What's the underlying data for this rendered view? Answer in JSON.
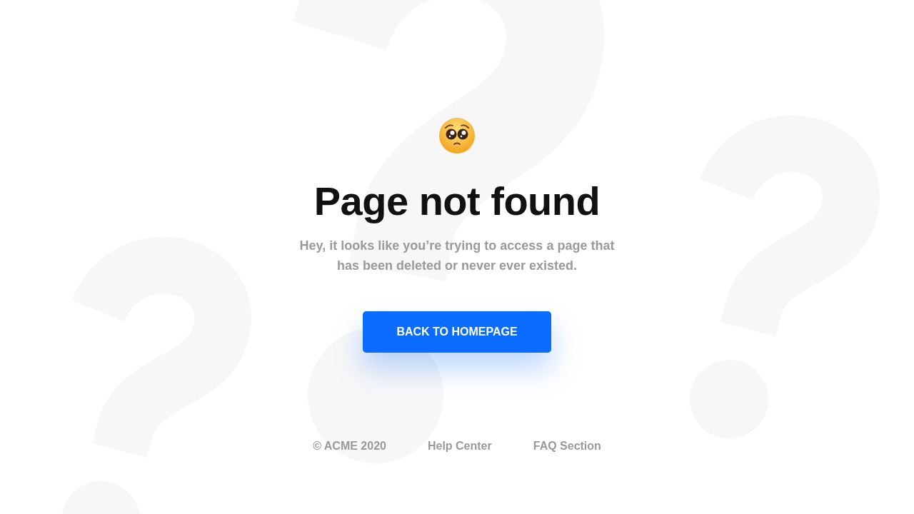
{
  "heading": "Page not found",
  "message": "Hey, it looks like you’re trying to access a page that has been deleted or never ever existed.",
  "button": {
    "label": "BACK TO HOMEPAGE"
  },
  "footer": [
    "© ACME 2020",
    "Help Center",
    "FAQ Section"
  ]
}
